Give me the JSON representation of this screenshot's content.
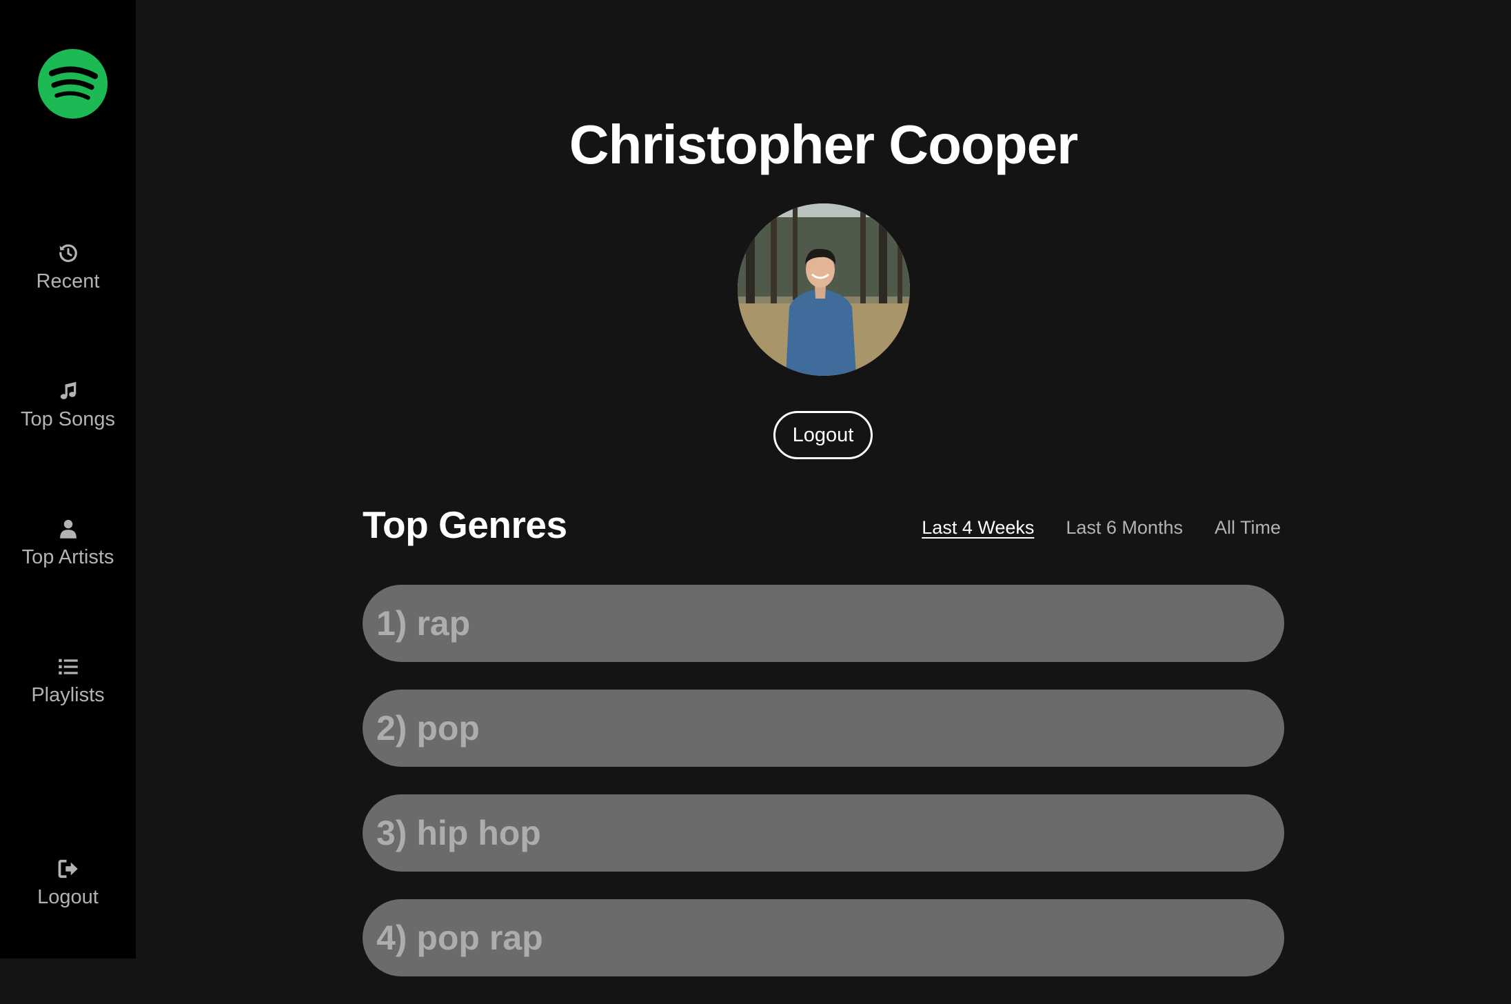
{
  "sidebar": {
    "logo_icon": "spotify-logo",
    "items": [
      {
        "label": "Recent",
        "icon": "history-icon"
      },
      {
        "label": "Top Songs",
        "icon": "music-note-icon"
      },
      {
        "label": "Top Artists",
        "icon": "user-icon"
      },
      {
        "label": "Playlists",
        "icon": "list-icon"
      }
    ],
    "logout": {
      "label": "Logout",
      "icon": "sign-out-icon"
    }
  },
  "profile": {
    "name": "Christopher Cooper",
    "logout_label": "Logout"
  },
  "genres": {
    "title": "Top Genres",
    "ranges": [
      {
        "label": "Last 4 Weeks",
        "active": true
      },
      {
        "label": "Last 6 Months",
        "active": false
      },
      {
        "label": "All Time",
        "active": false
      }
    ],
    "items": [
      {
        "label": "1) rap"
      },
      {
        "label": "2) pop"
      },
      {
        "label": "3) hip hop"
      },
      {
        "label": "4) pop rap"
      }
    ]
  },
  "colors": {
    "brand_green": "#1db954",
    "background": "#141414",
    "sidebar": "#000000",
    "genre_row": "#6b6b6b"
  }
}
